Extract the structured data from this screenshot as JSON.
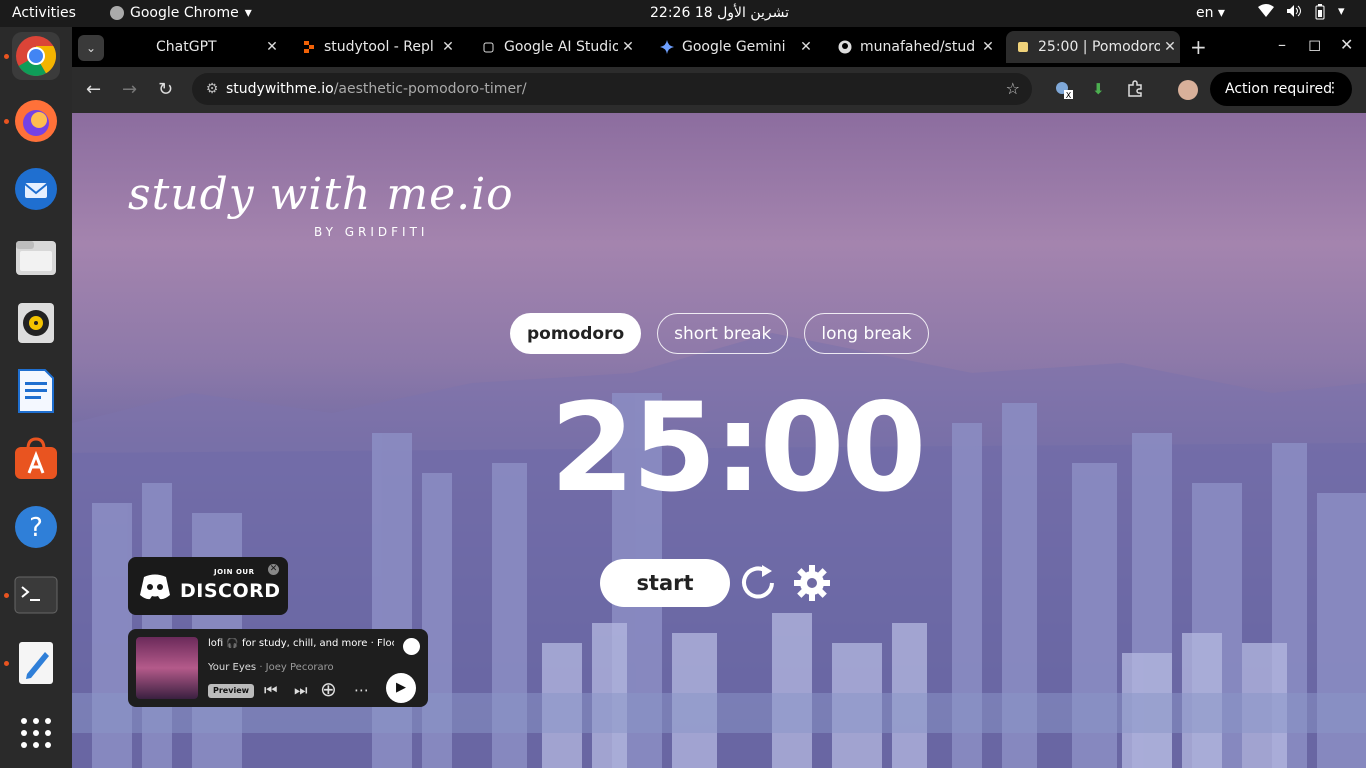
{
  "system_bar": {
    "activities": "Activities",
    "app_name": "Google Chrome",
    "app_arrow": "▾",
    "clock": "تشرين الأول 18  22:26",
    "language": "en ▾",
    "tray_icons": [
      "wifi-icon",
      "volume-icon",
      "battery-icon"
    ]
  },
  "dock": {
    "items": [
      {
        "name": "chrome",
        "icon": "chrome-icon",
        "running": true
      },
      {
        "name": "firefox",
        "icon": "firefox-icon",
        "running": true
      },
      {
        "name": "thunderbird",
        "icon": "thunderbird-icon",
        "running": false
      },
      {
        "name": "files",
        "icon": "files-icon",
        "running": false
      },
      {
        "name": "rhythmbox",
        "icon": "rhythmbox-icon",
        "running": false
      },
      {
        "name": "writer",
        "icon": "writer-icon",
        "running": false
      },
      {
        "name": "app-center",
        "icon": "app-center-icon",
        "running": false
      },
      {
        "name": "help",
        "icon": "help-icon",
        "running": false
      },
      {
        "name": "terminal",
        "icon": "terminal-icon",
        "running": true
      },
      {
        "name": "text-editor",
        "icon": "text-editor-icon",
        "running": true
      },
      {
        "name": "show-apps",
        "icon": "grid-icon",
        "running": false
      }
    ]
  },
  "tabs": [
    {
      "title": "ChatGPT",
      "icon": "chatgpt-icon",
      "close": "✕"
    },
    {
      "title": "studytool - Repl",
      "icon": "replit-icon",
      "close": "✕"
    },
    {
      "title": "Google AI Studio",
      "icon": "ai-studio-icon",
      "close": "✕"
    },
    {
      "title": "Google Gemini",
      "icon": "gemini-icon",
      "close": "✕"
    },
    {
      "title": "munafahed/stud",
      "icon": "github-icon",
      "close": "✕"
    },
    {
      "title": "25:00 | Pomodoro",
      "icon": "studywithme-icon",
      "close": "✕",
      "active": true
    }
  ],
  "window_controls": {
    "minimize": "–",
    "maximize": "◻",
    "close": "✕",
    "new_tab": "+"
  },
  "omnibox": {
    "host": "studywithme.io",
    "path": "/aesthetic-pomodoro-timer/"
  },
  "toolbar": {
    "action_label": "Action required"
  },
  "page": {
    "logo": "study with me.io",
    "by_line": "BY GRIDFITI",
    "modes": [
      "pomodoro",
      "short break",
      "long break"
    ],
    "active_mode": "pomodoro",
    "timer": "25:00",
    "start_label": "start",
    "discord": {
      "join": "JOIN OUR",
      "word": "DISCORD",
      "close": "✕"
    },
    "spotify": {
      "playlist": "lofi 🎧 for study, chill, and more · Floc",
      "song": "Your Eyes",
      "artist": "Joey Pecoraro",
      "preview": "Preview"
    }
  },
  "colors": {
    "accent": "#ffffff",
    "sky_top": "#a484ae",
    "sky_bottom": "#3f4a88"
  }
}
